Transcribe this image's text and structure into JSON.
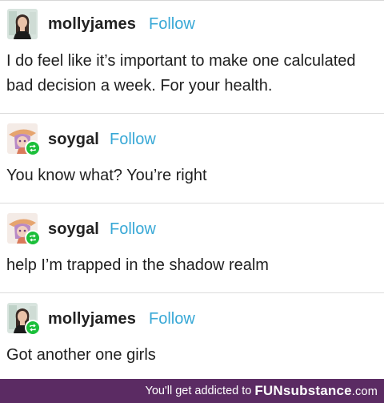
{
  "posts": [
    {
      "username": "mollyjames",
      "follow_label": "Follow",
      "text": "I do feel like it’s important to make one calculated bad decision a week. For your health.",
      "avatar": "mollyjames-avatar",
      "reblog": false
    },
    {
      "username": "soygal",
      "follow_label": "Follow",
      "text": "You know what? You’re right",
      "avatar": "soygal-avatar",
      "reblog": true
    },
    {
      "username": "soygal",
      "follow_label": "Follow",
      "text": "help I’m trapped in the shadow realm",
      "avatar": "soygal-avatar",
      "reblog": true
    },
    {
      "username": "mollyjames",
      "follow_label": "Follow",
      "text": "Got another one girls",
      "avatar": "mollyjames-avatar",
      "reblog": true
    }
  ],
  "footer": {
    "tagline": "You'll get addicted to",
    "brand_fun": "FUN",
    "brand_substance": "substance",
    "brand_tld": ".com"
  },
  "colors": {
    "follow": "#38a8d6",
    "footer_bg": "#5b2b63",
    "reblog_badge": "#1bbf3a"
  }
}
